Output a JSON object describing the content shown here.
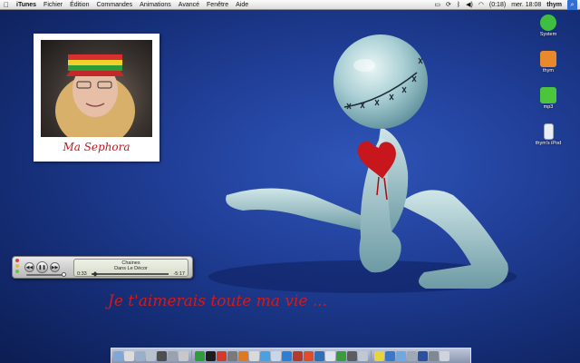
{
  "menubar": {
    "apple_glyph": "",
    "items": [
      "iTunes",
      "Fichier",
      "Édition",
      "Commandes",
      "Animations",
      "Avancé",
      "Fenêtre",
      "Aide"
    ],
    "status": {
      "battery": "(0:18)",
      "clock": "mer. 18:08",
      "user": "thym",
      "spotlight_glyph": "⌕"
    }
  },
  "photo_widget": {
    "caption": "Ma Sephora"
  },
  "desktop_icons": [
    {
      "label": "System",
      "icon": "drive-icon",
      "color": "#3fbf3f"
    },
    {
      "label": "thym",
      "icon": "home-folder-icon",
      "color": "#e8892c"
    },
    {
      "label": "mp3",
      "icon": "music-folder-icon",
      "color": "#4cc43c"
    },
    {
      "label": "thym's iPod",
      "icon": "ipod-icon",
      "color": "#e9eef6"
    }
  ],
  "mini_player": {
    "song": "Chaines",
    "album": "Dans Le Décor",
    "elapsed": "0:33",
    "remaining": "-5:17",
    "prev_glyph": "◀◀",
    "play_glyph": "❚❚",
    "next_glyph": "▶▶"
  },
  "phrase": "Je t'aimerais toute ma vie ...",
  "dock": {
    "icon_colors": [
      "#7fa8d8",
      "#dcdcdc",
      "#9ab0c8",
      "#b8c2cc",
      "#4e4e4e",
      "#9aa3ad",
      "#c8c8c8",
      "#2f9b3a",
      "#1d1d1d",
      "#d23a2a",
      "#7a7a7a",
      "#e07820",
      "#d9d9d9",
      "#4aa0e0",
      "#c8d6e8",
      "#2c7fd2",
      "#b53a2e",
      "#e04c2c",
      "#2f6fb8",
      "#dfe3ea",
      "#3b9c3b",
      "#5d5d5d",
      "#c0c8d2",
      "#e8d43c",
      "#3a78c8",
      "#70a8e0",
      "#9fa8b5",
      "#2c4fa0",
      "#808890",
      "#d0d4da"
    ],
    "separator_after": [
      6,
      22
    ]
  }
}
